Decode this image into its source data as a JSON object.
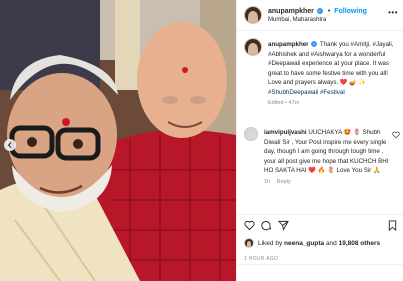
{
  "post": {
    "username": "anupampkher",
    "follow_label": "Following",
    "location": "Mumbai, Maharashtra"
  },
  "caption": {
    "username": "anupampkher",
    "text": "Thank you #Amitji, #Jayali, #Abhishek and #Aishwarya for a wonderful #Deepawali experience at your place. It was great to have some festive time with you all! Love and prayers always.",
    "tags": "#ShubhDeepawali #Festival",
    "edited_label": "Edited",
    "time": "47m"
  },
  "comment": {
    "username": "iamvipuljvashi",
    "text": "UUCHAKYA 🤩 🌷 Shubh Diwali Sir , Your Post inspire me every single day, though I am going through tough time , your all post give me hope that KUCHCH BHI HO SAKTA HAI",
    "text_end": "Love You Sir",
    "time": "1h",
    "reply_label": "Reply"
  },
  "likes": {
    "prefix": "Liked by",
    "user": "neena_gupta",
    "middle": "and",
    "count": "19,808 others"
  },
  "timestamp": "1 HOUR AGO",
  "icons": {
    "verified": "verified-badge-icon",
    "more": "more-options-icon",
    "heart": "heart-icon",
    "comment": "comment-icon",
    "share": "share-icon",
    "save": "bookmark-icon",
    "prev": "chevron-left-icon"
  },
  "colors": {
    "link_blue": "#0095f6",
    "tag_blue": "#00376b",
    "meta_gray": "#8e8e8e",
    "verified": "#3897f0"
  }
}
